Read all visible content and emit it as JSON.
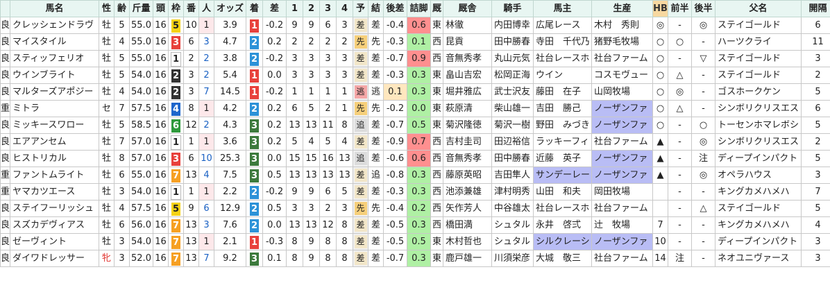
{
  "colors": {
    "frame1": "#ffffff",
    "frame2": "#333333",
    "frame3": "#e8413c",
    "frame4": "#1d66cc",
    "frame5": "#f5d215",
    "frame6": "#2f9a3c",
    "frame7": "#f6a023",
    "frame8": "#f7b5c8",
    "chaku1": "#e8413c",
    "chaku2": "#2c92d8",
    "chaku3": "#3c7a3c"
  },
  "headers": [
    "馬名",
    "性",
    "齢",
    "斤量",
    "頭",
    "枠",
    "番",
    "人",
    "オッズ",
    "着",
    "差",
    "1",
    "2",
    "3",
    "4",
    "予",
    "結",
    "後差",
    "詰脚",
    "厩",
    "厩舎",
    "騎手",
    "馬主",
    "生産",
    "HB",
    "前半",
    "後半",
    "父名",
    "開隔"
  ],
  "rows": [
    {
      "cond": "良",
      "name": "クレッシェンドラヴ",
      "sex": "牡",
      "age": "5",
      "kin": "55.0",
      "to": "16",
      "waku": "5",
      "ban": "10",
      "nin": "1",
      "odds": "3.9",
      "chaku": "1",
      "sa": "-0.2",
      "c1": "9",
      "c2": "9",
      "c3": "6",
      "c4": "3",
      "yoso": "差",
      "kek": "差",
      "kou": "-0.4",
      "ag": "0.6",
      "ew": "東",
      "trainer": "林徹",
      "jockey": "内田博幸",
      "owner": "広尾レース",
      "breed": "木村　秀則",
      "hb": "◎",
      "zen": "-",
      "kou2": "◎",
      "sire": "ステイゴールド",
      "gap": "6"
    },
    {
      "cond": "良",
      "name": "マイスタイル",
      "sex": "牡",
      "age": "4",
      "kin": "55.0",
      "to": "16",
      "waku": "3",
      "ban": "6",
      "nin": "3",
      "odds": "4.7",
      "chaku": "2",
      "sa": "0.2",
      "c1": "2",
      "c2": "2",
      "c3": "2",
      "c4": "2",
      "yoso": "先",
      "kek": "先",
      "kou": "-0.3",
      "ag": "0.1",
      "ew": "西",
      "trainer": "昆貢",
      "jockey": "田中勝春",
      "owner": "寺田　千代乃",
      "breed": "猪野毛牧場",
      "hb": "○",
      "zen": "○",
      "kou2": "-",
      "sire": "ハーツクライ",
      "gap": "11"
    },
    {
      "cond": "良",
      "name": "スティッフェリオ",
      "sex": "牡",
      "age": "5",
      "kin": "55.0",
      "to": "16",
      "waku": "1",
      "ban": "2",
      "nin": "2",
      "odds": "3.8",
      "chaku": "2",
      "sa": "-0.2",
      "c1": "3",
      "c2": "3",
      "c3": "3",
      "c4": "3",
      "yoso": "差",
      "kek": "差",
      "kou": "-0.7",
      "ag": "0.9",
      "ew": "西",
      "trainer": "音無秀孝",
      "jockey": "丸山元気",
      "owner": "社台レースホ",
      "breed": "社台ファーム",
      "hb": "○",
      "zen": "-",
      "kou2": "▽",
      "sire": "ステイゴールド",
      "gap": "3"
    },
    {
      "cond": "良",
      "name": "ウインブライト",
      "sex": "牡",
      "age": "5",
      "kin": "54.0",
      "to": "16",
      "waku": "2",
      "ban": "3",
      "nin": "2",
      "odds": "5.4",
      "chaku": "1",
      "sa": "0.0",
      "c1": "3",
      "c2": "3",
      "c3": "3",
      "c4": "3",
      "yoso": "差",
      "kek": "差",
      "kou": "-0.3",
      "ag": "0.3",
      "ew": "東",
      "trainer": "畠山吉宏",
      "jockey": "松岡正海",
      "owner": "ウイン",
      "breed": "コスモヴュー",
      "hb": "○",
      "zen": "△",
      "kou2": "-",
      "sire": "ステイゴールド",
      "gap": "2"
    },
    {
      "cond": "良",
      "name": "マルターズアポジー",
      "sex": "牡",
      "age": "4",
      "kin": "54.0",
      "to": "16",
      "waku": "2",
      "ban": "3",
      "nin": "7",
      "odds": "14.5",
      "chaku": "1",
      "sa": "-0.2",
      "c1": "1",
      "c2": "1",
      "c3": "1",
      "c4": "1",
      "yoso": "逃",
      "kek": "逃",
      "kou": "0.1",
      "ag": "0.3",
      "ew": "東",
      "trainer": "堀井雅広",
      "jockey": "武士沢友",
      "owner": "藤田　在子",
      "breed": "山岡牧場",
      "hb": "○",
      "zen": "◎",
      "kou2": "-",
      "sire": "ゴスホークケン",
      "gap": "5"
    },
    {
      "cond": "重",
      "name": "ミトラ",
      "sex": "セ",
      "age": "7",
      "kin": "57.5",
      "to": "16",
      "waku": "4",
      "ban": "8",
      "nin": "1",
      "odds": "4.2",
      "chaku": "2",
      "sa": "0.2",
      "c1": "6",
      "c2": "5",
      "c3": "2",
      "c4": "1",
      "yoso": "先",
      "kek": "先",
      "kou": "-0.2",
      "ag": "0.0",
      "ew": "東",
      "trainer": "萩原清",
      "jockey": "柴山雄一",
      "owner": "吉田　勝己",
      "breed": "ノーザンファ",
      "hb": "○",
      "zen": "△",
      "kou2": "-",
      "sire": "シンボリクリスエス",
      "gap": "6"
    },
    {
      "cond": "良",
      "name": "ミッキースワロー",
      "sex": "牡",
      "age": "5",
      "kin": "58.5",
      "to": "16",
      "waku": "6",
      "ban": "12",
      "nin": "2",
      "odds": "4.3",
      "chaku": "3",
      "sa": "0.2",
      "c1": "13",
      "c2": "13",
      "c3": "11",
      "c4": "8",
      "yoso": "追",
      "kek": "差",
      "kou": "-0.7",
      "ag": "0.5",
      "ew": "東",
      "trainer": "菊沢隆徳",
      "jockey": "菊沢一樹",
      "owner": "野田　みづき",
      "breed": "ノーザンファ",
      "hb": "○",
      "zen": "-",
      "kou2": "○",
      "sire": "トーセンホマレボシ",
      "gap": "5"
    },
    {
      "cond": "良",
      "name": "エアアンセム",
      "sex": "牡",
      "age": "7",
      "kin": "57.0",
      "to": "16",
      "waku": "1",
      "ban": "1",
      "nin": "1",
      "odds": "3.6",
      "chaku": "3",
      "sa": "0.2",
      "c1": "5",
      "c2": "4",
      "c3": "5",
      "c4": "4",
      "yoso": "差",
      "kek": "差",
      "kou": "-0.9",
      "ag": "0.7",
      "ew": "西",
      "trainer": "吉村圭司",
      "jockey": "田辺裕信",
      "owner": "ラッキーフィ",
      "breed": "社台ファーム",
      "hb": "▲",
      "zen": "-",
      "kou2": "◎",
      "sire": "シンボリクリスエス",
      "gap": "2"
    },
    {
      "cond": "良",
      "name": "ヒストリカル",
      "sex": "牡",
      "age": "8",
      "kin": "57.0",
      "to": "16",
      "waku": "3",
      "ban": "6",
      "nin": "10",
      "odds": "25.3",
      "chaku": "3",
      "sa": "0.0",
      "c1": "15",
      "c2": "15",
      "c3": "16",
      "c4": "13",
      "yoso": "追",
      "kek": "差",
      "kou": "-0.6",
      "ag": "0.6",
      "ew": "西",
      "trainer": "音無秀孝",
      "jockey": "田中勝春",
      "owner": "近藤　英子",
      "breed": "ノーザンファ",
      "hb": "▲",
      "zen": "-",
      "kou2": "注",
      "sire": "ディープインパクト",
      "gap": "5"
    },
    {
      "cond": "重",
      "name": "ファントムライト",
      "sex": "牡",
      "age": "6",
      "kin": "55.0",
      "to": "16",
      "waku": "7",
      "ban": "13",
      "nin": "4",
      "odds": "7.5",
      "chaku": "3",
      "sa": "0.5",
      "c1": "13",
      "c2": "13",
      "c3": "13",
      "c4": "13",
      "yoso": "差",
      "kek": "追",
      "kou": "-0.8",
      "ag": "0.3",
      "ew": "西",
      "trainer": "藤原英昭",
      "jockey": "吉田隼人",
      "owner": "サンデーレー",
      "breed": "ノーザンファ",
      "hb": "▲",
      "zen": "-",
      "kou2": "◎",
      "sire": "オペラハウス",
      "gap": "3"
    },
    {
      "cond": "重",
      "name": "ヤマカツエース",
      "sex": "牡",
      "age": "3",
      "kin": "54.0",
      "to": "16",
      "waku": "1",
      "ban": "1",
      "nin": "1",
      "odds": "2.2",
      "chaku": "2",
      "sa": "-0.2",
      "c1": "9",
      "c2": "9",
      "c3": "6",
      "c4": "5",
      "yoso": "差",
      "kek": "差",
      "kou": "-0.3",
      "ag": "0.3",
      "ew": "西",
      "trainer": "池添兼雄",
      "jockey": "津村明秀",
      "owner": "山田　和夫",
      "breed": "岡田牧場",
      "hb": "",
      "zen": "-",
      "kou2": "-",
      "sire": "キングカメハメハ",
      "gap": "7"
    },
    {
      "cond": "良",
      "name": "ステイフーリッシュ",
      "sex": "牡",
      "age": "4",
      "kin": "57.5",
      "to": "16",
      "waku": "5",
      "ban": "9",
      "nin": "6",
      "odds": "12.9",
      "chaku": "2",
      "sa": "0.5",
      "c1": "3",
      "c2": "3",
      "c3": "2",
      "c4": "3",
      "yoso": "先",
      "kek": "先",
      "kou": "-0.4",
      "ag": "0.2",
      "ew": "西",
      "trainer": "矢作芳人",
      "jockey": "中谷雄太",
      "owner": "社台レースホ",
      "breed": "社台ファーム",
      "hb": "",
      "zen": "-",
      "kou2": "△",
      "sire": "ステイゴールド",
      "gap": "5"
    },
    {
      "cond": "良",
      "name": "スズカデヴィアス",
      "sex": "牡",
      "age": "6",
      "kin": "56.0",
      "to": "16",
      "waku": "7",
      "ban": "13",
      "nin": "3",
      "odds": "7.6",
      "chaku": "2",
      "sa": "0.0",
      "c1": "13",
      "c2": "13",
      "c3": "12",
      "c4": "8",
      "yoso": "差",
      "kek": "差",
      "kou": "-0.5",
      "ag": "0.3",
      "ew": "西",
      "trainer": "橋田満",
      "jockey": "シュタル",
      "owner": "永井　啓弍",
      "breed": "辻　牧場",
      "hb": "7",
      "zen": "-",
      "kou2": "-",
      "sire": "キングカメハメハ",
      "gap": "4"
    },
    {
      "cond": "良",
      "name": "ゼーヴィント",
      "sex": "牡",
      "age": "3",
      "kin": "54.0",
      "to": "16",
      "waku": "7",
      "ban": "13",
      "nin": "1",
      "odds": "2.1",
      "chaku": "1",
      "sa": "-0.3",
      "c1": "8",
      "c2": "9",
      "c3": "8",
      "c4": "8",
      "yoso": "差",
      "kek": "差",
      "kou": "-0.5",
      "ag": "0.5",
      "ew": "東",
      "trainer": "木村哲也",
      "jockey": "シュタル",
      "owner": "シルクレーシ",
      "breed": "ノーザンファ",
      "hb": "10",
      "zen": "-",
      "kou2": "-",
      "sire": "ディープインパクト",
      "gap": "3"
    },
    {
      "cond": "良",
      "name": "ダイワドレッサー",
      "sex": "牝",
      "age": "3",
      "kin": "52.0",
      "to": "16",
      "waku": "7",
      "ban": "13",
      "nin": "7",
      "odds": "9.2",
      "chaku": "3",
      "sa": "0.1",
      "c1": "8",
      "c2": "9",
      "c3": "8",
      "c4": "8",
      "yoso": "差",
      "kek": "差",
      "kou": "-0.7",
      "ag": "0.3",
      "ew": "東",
      "trainer": "鹿戸雄一",
      "jockey": "川須栄彦",
      "owner": "大城　敬三",
      "breed": "社台ファーム",
      "hb": "14",
      "zen": "注",
      "kou2": "-",
      "sire": "ネオユニヴァース",
      "gap": "3"
    }
  ]
}
